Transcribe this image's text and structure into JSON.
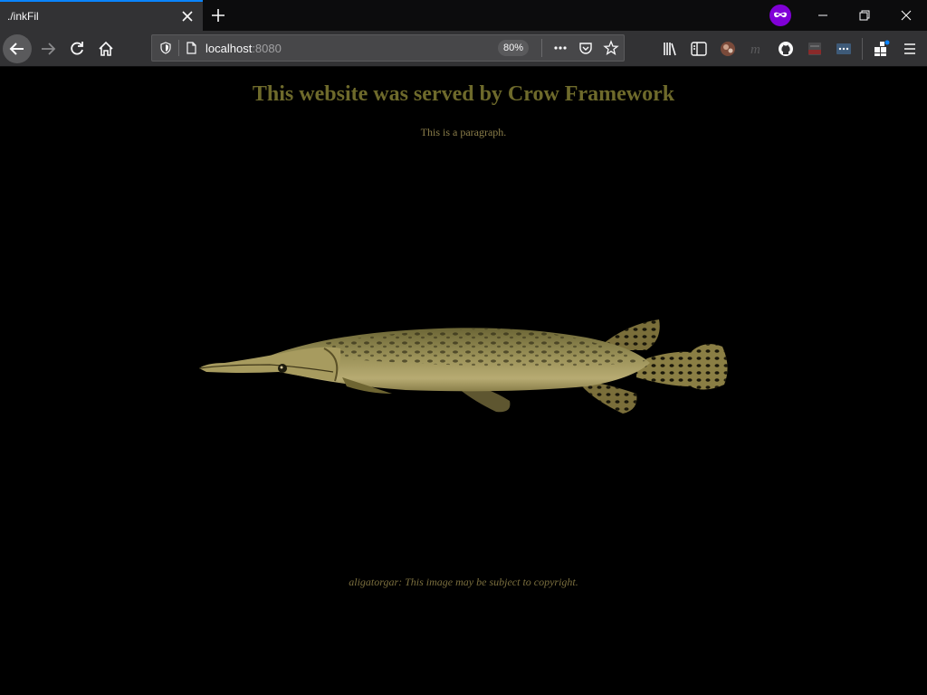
{
  "tab": {
    "title": "./inkFil"
  },
  "urlbar": {
    "host": "localhost",
    "port": ":8080",
    "zoom": "80%"
  },
  "page": {
    "title": "This website was served by Crow Framework",
    "paragraph": "This is a paragraph.",
    "image_alt": "aligatorgar",
    "caption": "aligatorgar: This image may be subject to copyright."
  },
  "colors": {
    "heading": "#6e6a2b",
    "text": "#8b7e4a",
    "background": "#000000",
    "tab_accent": "#0a84ff"
  },
  "icons": {
    "toolbar": [
      "library-icon",
      "sidebar-icon",
      "profile-avatar-icon",
      "extension-m-icon",
      "github-icon",
      "pdf-extension-icon",
      "more-extension-icon",
      "extensions-icon",
      "menu-icon"
    ]
  }
}
